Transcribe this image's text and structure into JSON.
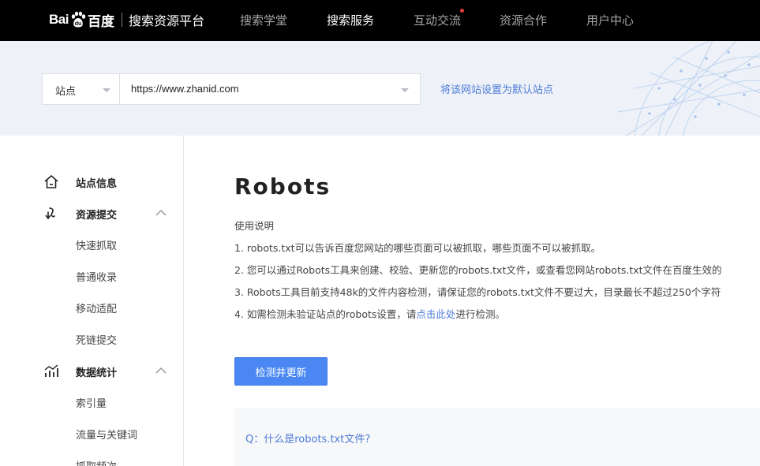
{
  "header": {
    "logo_bai": "Bai",
    "logo_du": "百度",
    "platform_name": "搜索资源平台",
    "nav": [
      {
        "label": "搜索学堂",
        "active": false
      },
      {
        "label": "搜索服务",
        "active": true
      },
      {
        "label": "互动交流",
        "active": false,
        "has_dot": true
      },
      {
        "label": "资源合作",
        "active": false
      },
      {
        "label": "用户中心",
        "active": false
      }
    ]
  },
  "site_bar": {
    "type_label": "站点",
    "site_url": "https://www.zhanid.com",
    "set_default_label": "将该网站设置为默认站点"
  },
  "sidebar": {
    "site_info": {
      "title": "站点信息",
      "icon": "home-icon"
    },
    "resource_submit": {
      "title": "资源提交",
      "icon": "submit-icon",
      "items": [
        "快速抓取",
        "普通收录",
        "移动适配",
        "死链提交"
      ]
    },
    "data_stats": {
      "title": "数据统计",
      "icon": "stats-icon",
      "items": [
        "索引量",
        "流量与关键词",
        "抓取频次"
      ]
    }
  },
  "main": {
    "title": "Robots",
    "usage_title": "使用说明",
    "lines": [
      "1. robots.txt可以告诉百度您网站的哪些页面可以被抓取，哪些页面不可以被抓取。",
      "2. 您可以通过Robots工具来创建、校验、更新您的robots.txt文件，或查看您网站robots.txt文件在百度生效的",
      "3. Robots工具目前支持48k的文件内容检测，请保证您的robots.txt文件不要过大，目录最长不超过250个字符"
    ],
    "line4_prefix": "4. 如需检测未验证站点的robots设置，请",
    "line4_link": "点击此处",
    "line4_suffix": "进行检测。",
    "check_button": "检测并更新",
    "faq_question": "Q：什么是robots.txt文件?"
  },
  "colors": {
    "nav_bg": "#000000",
    "banner_bg": "#eef2f8",
    "link": "#4d7bd7",
    "primary_button": "#4a87f3",
    "notification_dot": "#e0403e"
  }
}
